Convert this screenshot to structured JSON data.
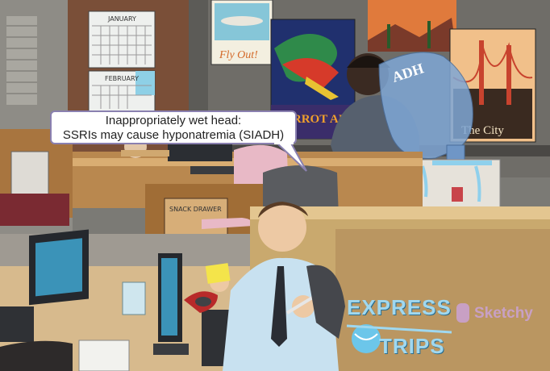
{
  "callout": {
    "line1": "Inappropriately wet head:",
    "line2": "SSRIs may cause hyponatremia (SIADH)"
  },
  "calendar": {
    "month_top": "JANUARY",
    "month_bottom": "FEBRUARY"
  },
  "posters": {
    "fly": "Fly Out!",
    "parrot": "PARROT AIR",
    "city": "The City"
  },
  "jug_label": "ADH",
  "snack_drawer_label": "SNACK DRAWER",
  "logo": {
    "express": "EXPRESS",
    "trips": "TRIPS",
    "brand": "Sketchy"
  },
  "colors": {
    "wall": "#7b7a75",
    "cubicle_wall": "#c9a96e",
    "desk": "#d8b98a",
    "callout_border": "#8a80b0",
    "logo_blue": "#9fd8f0"
  }
}
